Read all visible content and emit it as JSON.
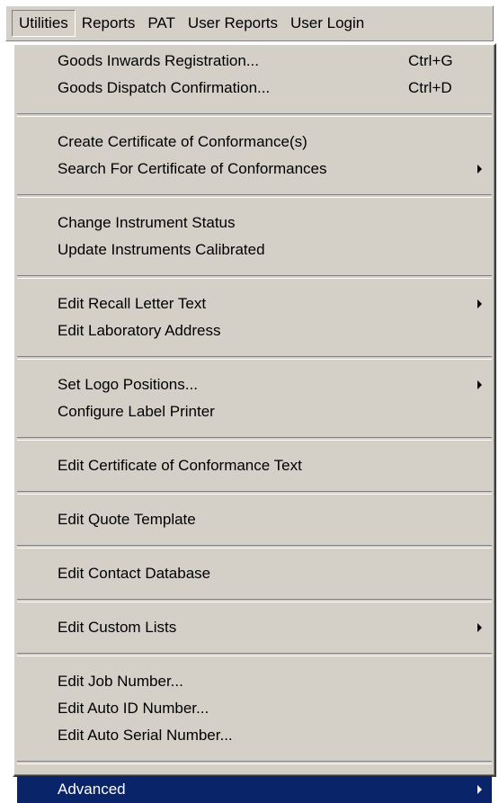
{
  "menubar": {
    "items": [
      {
        "label": "Utilities"
      },
      {
        "label": "Reports"
      },
      {
        "label": "PAT"
      },
      {
        "label": "User Reports"
      },
      {
        "label": "User Login"
      }
    ]
  },
  "menu": {
    "groups": [
      {
        "items": [
          {
            "label": "Goods Inwards Registration...",
            "shortcut": "Ctrl+G"
          },
          {
            "label": "Goods Dispatch Confirmation...",
            "shortcut": "Ctrl+D"
          }
        ]
      },
      {
        "items": [
          {
            "label": "Create Certificate of Conformance(s)"
          },
          {
            "label": "Search For Certificate of Conformances",
            "submenu": true
          }
        ]
      },
      {
        "items": [
          {
            "label": "Change Instrument Status"
          },
          {
            "label": "Update Instruments Calibrated"
          }
        ]
      },
      {
        "items": [
          {
            "label": "Edit Recall Letter Text",
            "submenu": true
          },
          {
            "label": "Edit Laboratory Address"
          }
        ]
      },
      {
        "items": [
          {
            "label": "Set Logo Positions...",
            "submenu": true
          },
          {
            "label": "Configure Label Printer"
          }
        ]
      },
      {
        "items": [
          {
            "label": "Edit Certificate of Conformance Text"
          }
        ]
      },
      {
        "items": [
          {
            "label": "Edit Quote Template"
          }
        ]
      },
      {
        "items": [
          {
            "label": "Edit Contact Database"
          }
        ]
      },
      {
        "items": [
          {
            "label": "Edit Custom Lists",
            "submenu": true
          }
        ]
      },
      {
        "items": [
          {
            "label": "Edit Job Number..."
          },
          {
            "label": "Edit Auto ID Number..."
          },
          {
            "label": "Edit Auto Serial Number..."
          }
        ]
      },
      {
        "items": [
          {
            "label": "Advanced",
            "submenu": true,
            "selected": true
          }
        ]
      }
    ]
  },
  "colors": {
    "menu_bg": "#d4d0c8",
    "highlight": "#0a246a"
  }
}
